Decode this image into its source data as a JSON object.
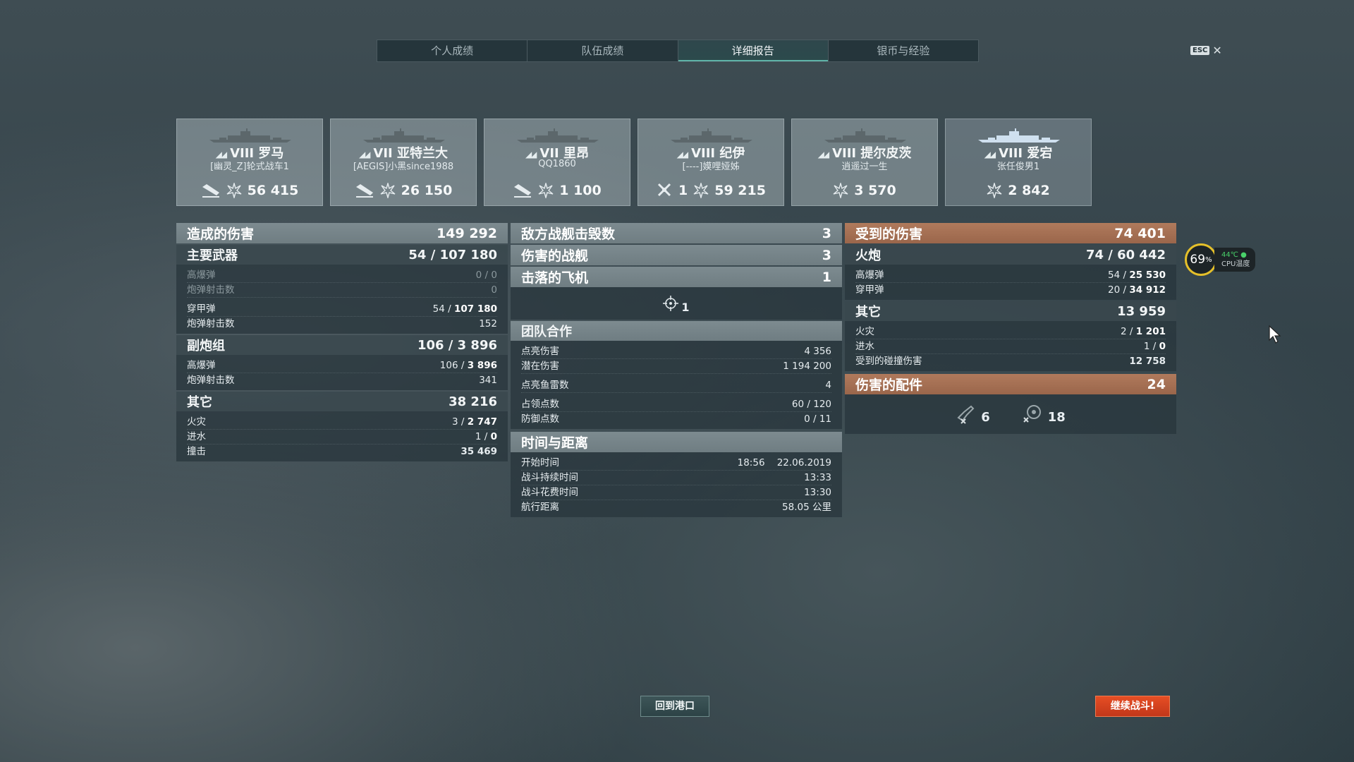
{
  "tabs": [
    {
      "label": "个人成绩",
      "active": false
    },
    {
      "label": "队伍成绩",
      "active": false
    },
    {
      "label": "详细报告",
      "active": true
    },
    {
      "label": "银币与经验",
      "active": false
    }
  ],
  "esc_label": "ESC",
  "close_glyph": "✕",
  "players": [
    {
      "tier": "VIII",
      "ship": "罗马",
      "player": "[幽灵_Z]轮式战车1",
      "kill_icon": "ship-sunk-icon",
      "kills": "",
      "damage": "56 415"
    },
    {
      "tier": "VII",
      "ship": "亚特兰大",
      "player": "[AEGIS]小黑since1988",
      "kill_icon": "ship-sunk-icon",
      "kills": "",
      "damage": "26 150"
    },
    {
      "tier": "VII",
      "ship": "里昂",
      "player": "QQ1860",
      "kill_icon": "ship-sunk-icon",
      "kills": "",
      "damage": "1 100"
    },
    {
      "tier": "VIII",
      "ship": "纪伊",
      "player": "[----]嫫哩娅姊",
      "kill_icon": "plane-shot-icon",
      "kills": "1",
      "damage": "59 215"
    },
    {
      "tier": "VIII",
      "ship": "提尔皮茨",
      "player": "逍遥过一生",
      "kill_icon": "",
      "kills": "",
      "damage": "3 570"
    },
    {
      "tier": "VIII",
      "ship": "爱宕",
      "player": "张任俊男1",
      "kill_icon": "",
      "kills": "",
      "damage": "2 842"
    }
  ],
  "left": {
    "damage_dealt": {
      "label": "造成的伤害",
      "value": "149 292"
    },
    "main_battery": {
      "label": "主要武器",
      "value_a": "54",
      "value_b": "107 180",
      "rows": [
        {
          "label": "高爆弹",
          "a": "0",
          "b": "0",
          "dim": true
        },
        {
          "label": "炮弹射击数",
          "a": "",
          "b": "0",
          "dim": true
        },
        {
          "label": "穿甲弹",
          "a": "54",
          "b": "107 180",
          "dim": false
        },
        {
          "label": "炮弹射击数",
          "a": "",
          "b": "152",
          "dim": false
        }
      ]
    },
    "secondary": {
      "label": "副炮组",
      "value_a": "106",
      "value_b": "3 896",
      "rows": [
        {
          "label": "高爆弹",
          "a": "106",
          "b": "3 896"
        },
        {
          "label": "炮弹射击数",
          "a": "",
          "b": "341"
        }
      ]
    },
    "other": {
      "label": "其它",
      "value": "38 216",
      "rows": [
        {
          "label": "火灾",
          "a": "3",
          "b": "2 747"
        },
        {
          "label": "进水",
          "a": "1",
          "b": "0"
        },
        {
          "label": "撞击",
          "a": "",
          "b": "35 469"
        }
      ]
    }
  },
  "mid": {
    "destroyed": {
      "label": "敌方战舰击毁数",
      "value": "3"
    },
    "damaged": {
      "label": "伤害的战舰",
      "value": "3"
    },
    "planes": {
      "label": "击落的飞机",
      "value": "1"
    },
    "planes_icon_count": "1",
    "teamwork": {
      "label": "团队合作",
      "rows": [
        {
          "label": "点亮伤害",
          "value": "4 356"
        },
        {
          "label": "潜在伤害",
          "value": "1 194 200"
        },
        {
          "label": "点亮鱼雷数",
          "value": "4"
        },
        {
          "label": "占领点数",
          "value": "60 / 120"
        },
        {
          "label": "防御点数",
          "value": "0 / 11"
        }
      ]
    },
    "time": {
      "label": "时间与距离",
      "rows": [
        {
          "label": "开始时间",
          "value": "18:56    22.06.2019"
        },
        {
          "label": "战斗持续时间",
          "value": "13:33"
        },
        {
          "label": "战斗花费时间",
          "value": "13:30"
        },
        {
          "label": "航行距离",
          "value": "58.05 公里"
        }
      ]
    }
  },
  "right": {
    "received": {
      "label": "受到的伤害",
      "value": "74 401"
    },
    "artillery": {
      "label": "火炮",
      "value_a": "74",
      "value_b": "60 442",
      "rows": [
        {
          "label": "高爆弹",
          "a": "54",
          "b": "25 530"
        },
        {
          "label": "穿甲弹",
          "a": "20",
          "b": "34 912"
        }
      ]
    },
    "other": {
      "label": "其它",
      "value": "13 959",
      "rows": [
        {
          "label": "火灾",
          "a": "2",
          "b": "1 201"
        },
        {
          "label": "进水",
          "a": "1",
          "b": "0"
        },
        {
          "label": "受到的碰撞伤害",
          "a": "",
          "b": "12 758"
        }
      ]
    },
    "modules": {
      "label": "伤害的配件",
      "value": "24",
      "gun_count": "6",
      "steering_count": "18"
    }
  },
  "buttons": {
    "port": "回到港口",
    "battle": "继续战斗!"
  },
  "cpu": {
    "percent": "69",
    "percent_sign": "%",
    "temp": "44℃",
    "label": "CPU温度"
  },
  "colors": {
    "accent_orange": "#9a664b",
    "battle_button": "#d8401e",
    "active_tab": "#5fb3a8"
  }
}
